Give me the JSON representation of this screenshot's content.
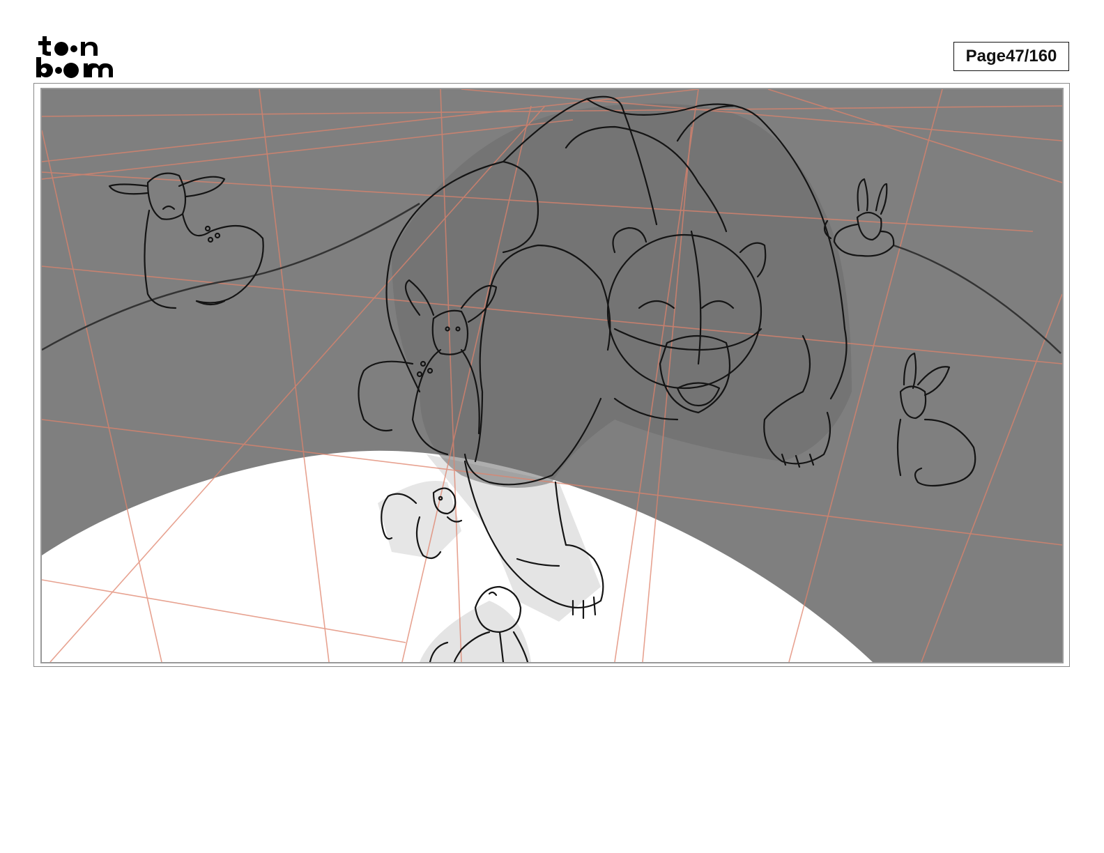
{
  "header": {
    "logo_top": "toon",
    "logo_bottom": "boom",
    "page_label": "Page",
    "page_number": "47/160"
  },
  "panel": {
    "shadow_color": "#7f7f7f",
    "light_color": "#ffffff",
    "guide_color": "#e0836c",
    "ink_color": "#141414",
    "figures": [
      "bear",
      "fawn",
      "deer",
      "rabbit",
      "rabbit",
      "rabbit",
      "squirrel",
      "rabbit"
    ]
  }
}
